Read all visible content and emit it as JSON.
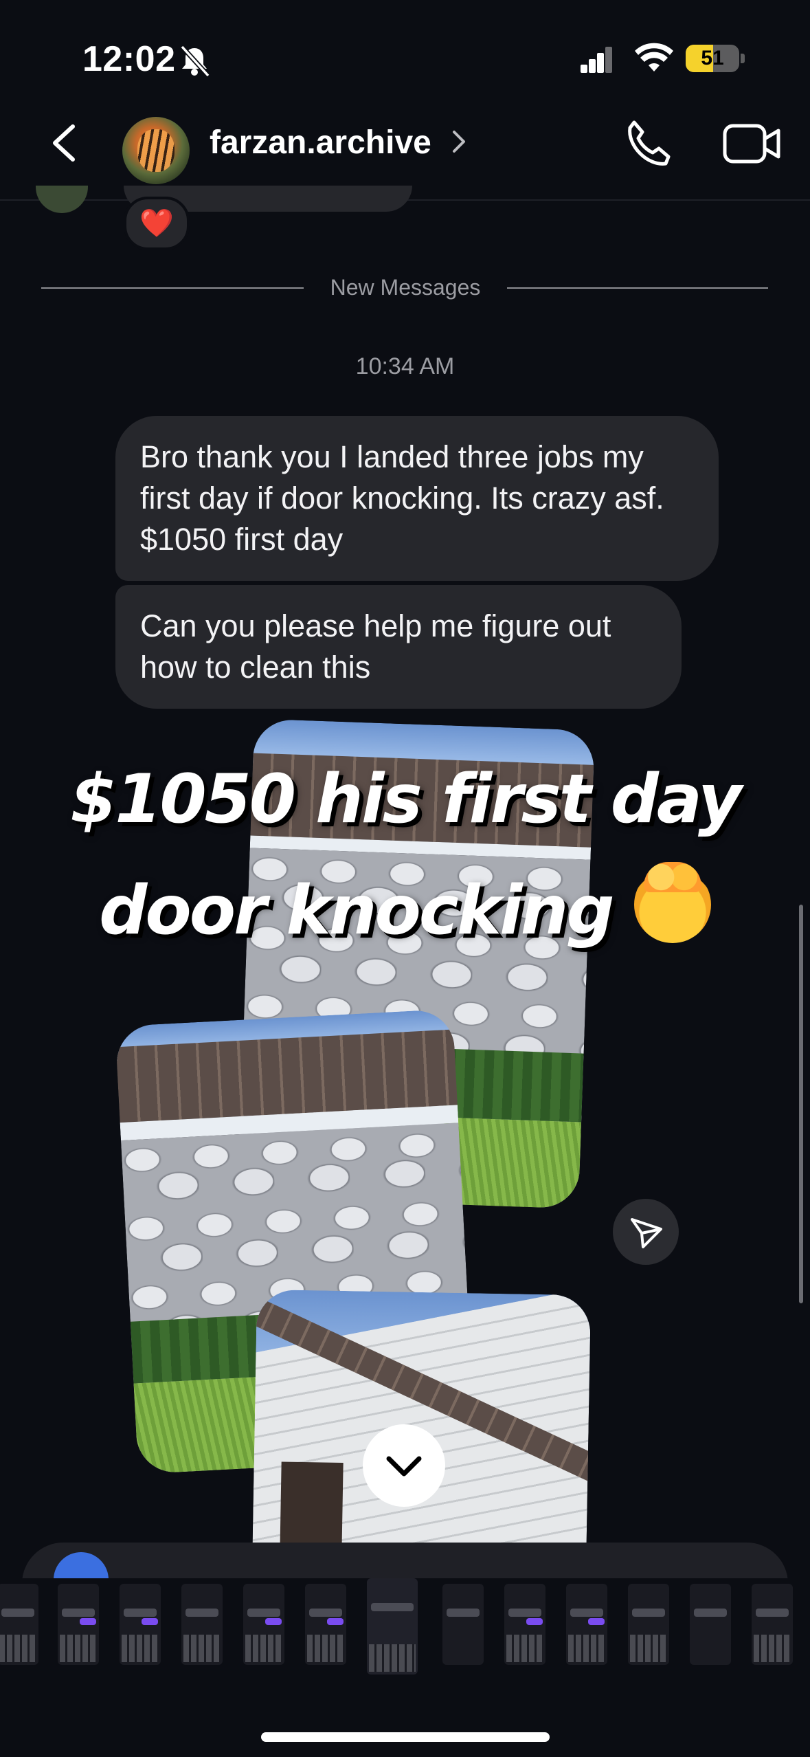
{
  "status_bar": {
    "time": "12:02",
    "battery": "51",
    "battery_level": 0.51
  },
  "header": {
    "username": "farzan.archive"
  },
  "chat": {
    "reaction": "❤️",
    "new_messages_label": "New Messages",
    "timestamp": "10:34 AM",
    "messages": [
      {
        "text": "Bro thank you I landed three jobs my first day if door knocking. Its crazy asf. $1050 first day"
      },
      {
        "text": "Can you please help me figure out how to clean this"
      }
    ],
    "shared_post": {
      "overlay_line1": "$1050 his first day",
      "overlay_line2": "door knocking"
    }
  },
  "colors": {
    "background": "#0b0d13",
    "bubble": "#26272c",
    "battery": "#f5d22c"
  },
  "icons": [
    "back-icon",
    "phone-icon",
    "video-icon",
    "share-icon",
    "chevron-down-icon",
    "bell-slash-icon",
    "wifi-icon",
    "signal-icon"
  ]
}
